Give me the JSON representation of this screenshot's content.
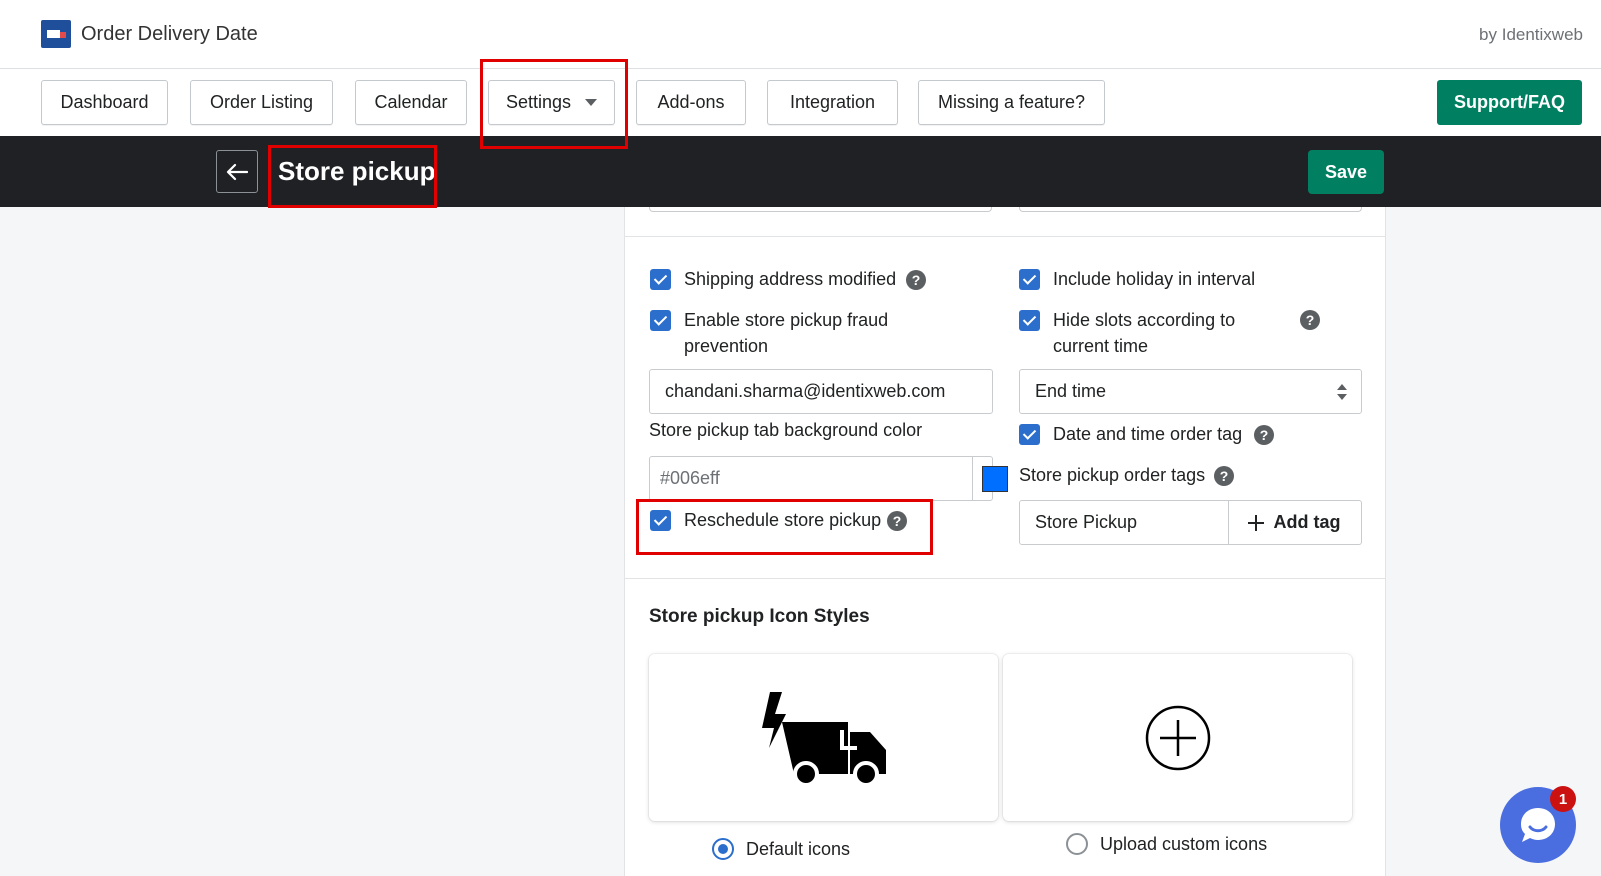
{
  "app": {
    "title": "Order Delivery Date",
    "vendor": "by Identixweb"
  },
  "nav": {
    "items": [
      "Dashboard",
      "Order Listing",
      "Calendar",
      "Settings",
      "Add-ons",
      "Integration",
      "Missing a feature?"
    ],
    "support": "Support/FAQ"
  },
  "header": {
    "title": "Store pickup",
    "save": "Save"
  },
  "form": {
    "shipping_address_modified": "Shipping address modified",
    "fraud_line1": "Enable store pickup fraud",
    "fraud_line2": "prevention",
    "email": "chandani.sharma@identixweb.com",
    "bg_color_label": "Store pickup tab background color",
    "bg_color_value": "#006eff",
    "reschedule": "Reschedule store pickup",
    "include_holiday": "Include holiday in interval",
    "hide_slots_line1": "Hide slots according to",
    "hide_slots_line2": "current time",
    "slot_select": "End time",
    "order_tag": "Date and time order tag",
    "tags_label": "Store pickup order tags",
    "tag_value": "Store Pickup",
    "add_tag": "Add tag",
    "help": "?"
  },
  "icon_styles": {
    "title": "Store pickup Icon Styles",
    "default_label": "Default icons",
    "custom_label": "Upload custom icons"
  },
  "chat": {
    "badge": "1"
  },
  "colors": {
    "accent": "#008060",
    "checkbox": "#2c6ecb",
    "highlight": "#e00000",
    "swatch": "#006eff"
  }
}
